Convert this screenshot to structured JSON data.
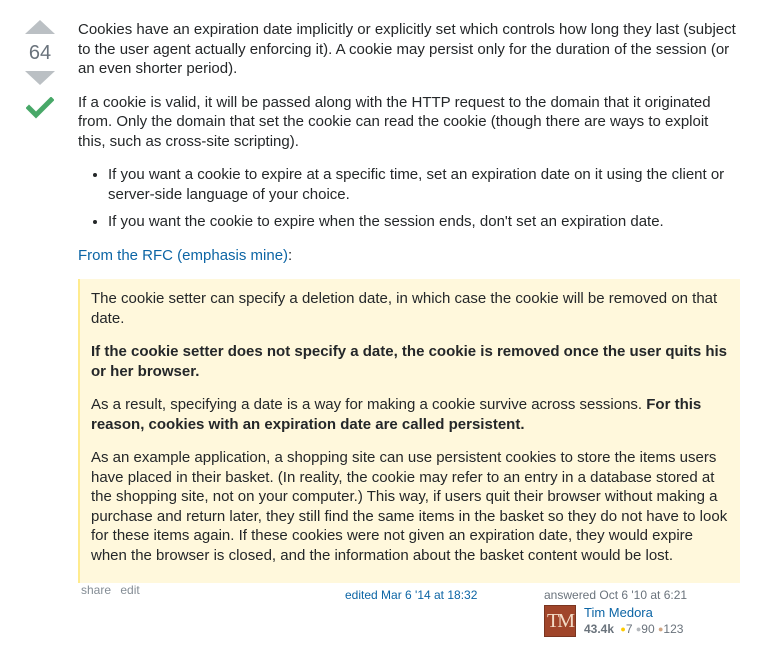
{
  "vote": {
    "score": "64"
  },
  "body": {
    "p1": "Cookies have an expiration date implicitly or explicitly set which controls how long they last (subject to the user agent actually enforcing it). A cookie may persist only for the duration of the session (or an even shorter period).",
    "p2": "If a cookie is valid, it will be passed along with the HTTP request to the domain that it originated from. Only the domain that set the cookie can read the cookie (though there are ways to exploit this, such as cross-site scripting).",
    "bullets": [
      "If you want a cookie to expire at a specific time, set an expiration date on it using the client or server-side language of your choice.",
      "If you want the cookie to expire when the session ends, don't set an expiration date."
    ],
    "rfc_link": "From the RFC (emphasis mine)",
    "rfc_colon": ":"
  },
  "quote": {
    "q1": "The cookie setter can specify a deletion date, in which case the cookie will be removed on that date.",
    "q2_bold": "If the cookie setter does not specify a date, the cookie is removed once the user quits his or her browser.",
    "q3_plain": "As a result, specifying a date is a way for making a cookie survive across sessions. ",
    "q3_bold": "For this reason, cookies with an expiration date are called persistent.",
    "q4": "As an example application, a shopping site can use persistent cookies to store the items users have placed in their basket. (In reality, the cookie may refer to an entry in a database stored at the shopping site, not on your computer.) This way, if users quit their browser without making a purchase and return later, they still find the same items in the basket so they do not have to look for these items again. If these cookies were not given an expiration date, they would expire when the browser is closed, and the information about the basket content would be lost."
  },
  "footer": {
    "share": "share",
    "edit": "edit",
    "edited": "edited Mar 6 '14 at 18:32",
    "answered": "answered Oct 6 '10 at 6:21",
    "user": {
      "name": "Tim Medora",
      "avatar_text": "TM",
      "reputation": "43.4k",
      "gold": "7",
      "silver": "90",
      "bronze": "123"
    }
  },
  "colors": {
    "link": "#0c65a5",
    "accepted": "#48a868",
    "quote_bg": "#fff8dc"
  },
  "icons": [
    "upvote-icon",
    "downvote-icon",
    "accepted-check-icon"
  ]
}
